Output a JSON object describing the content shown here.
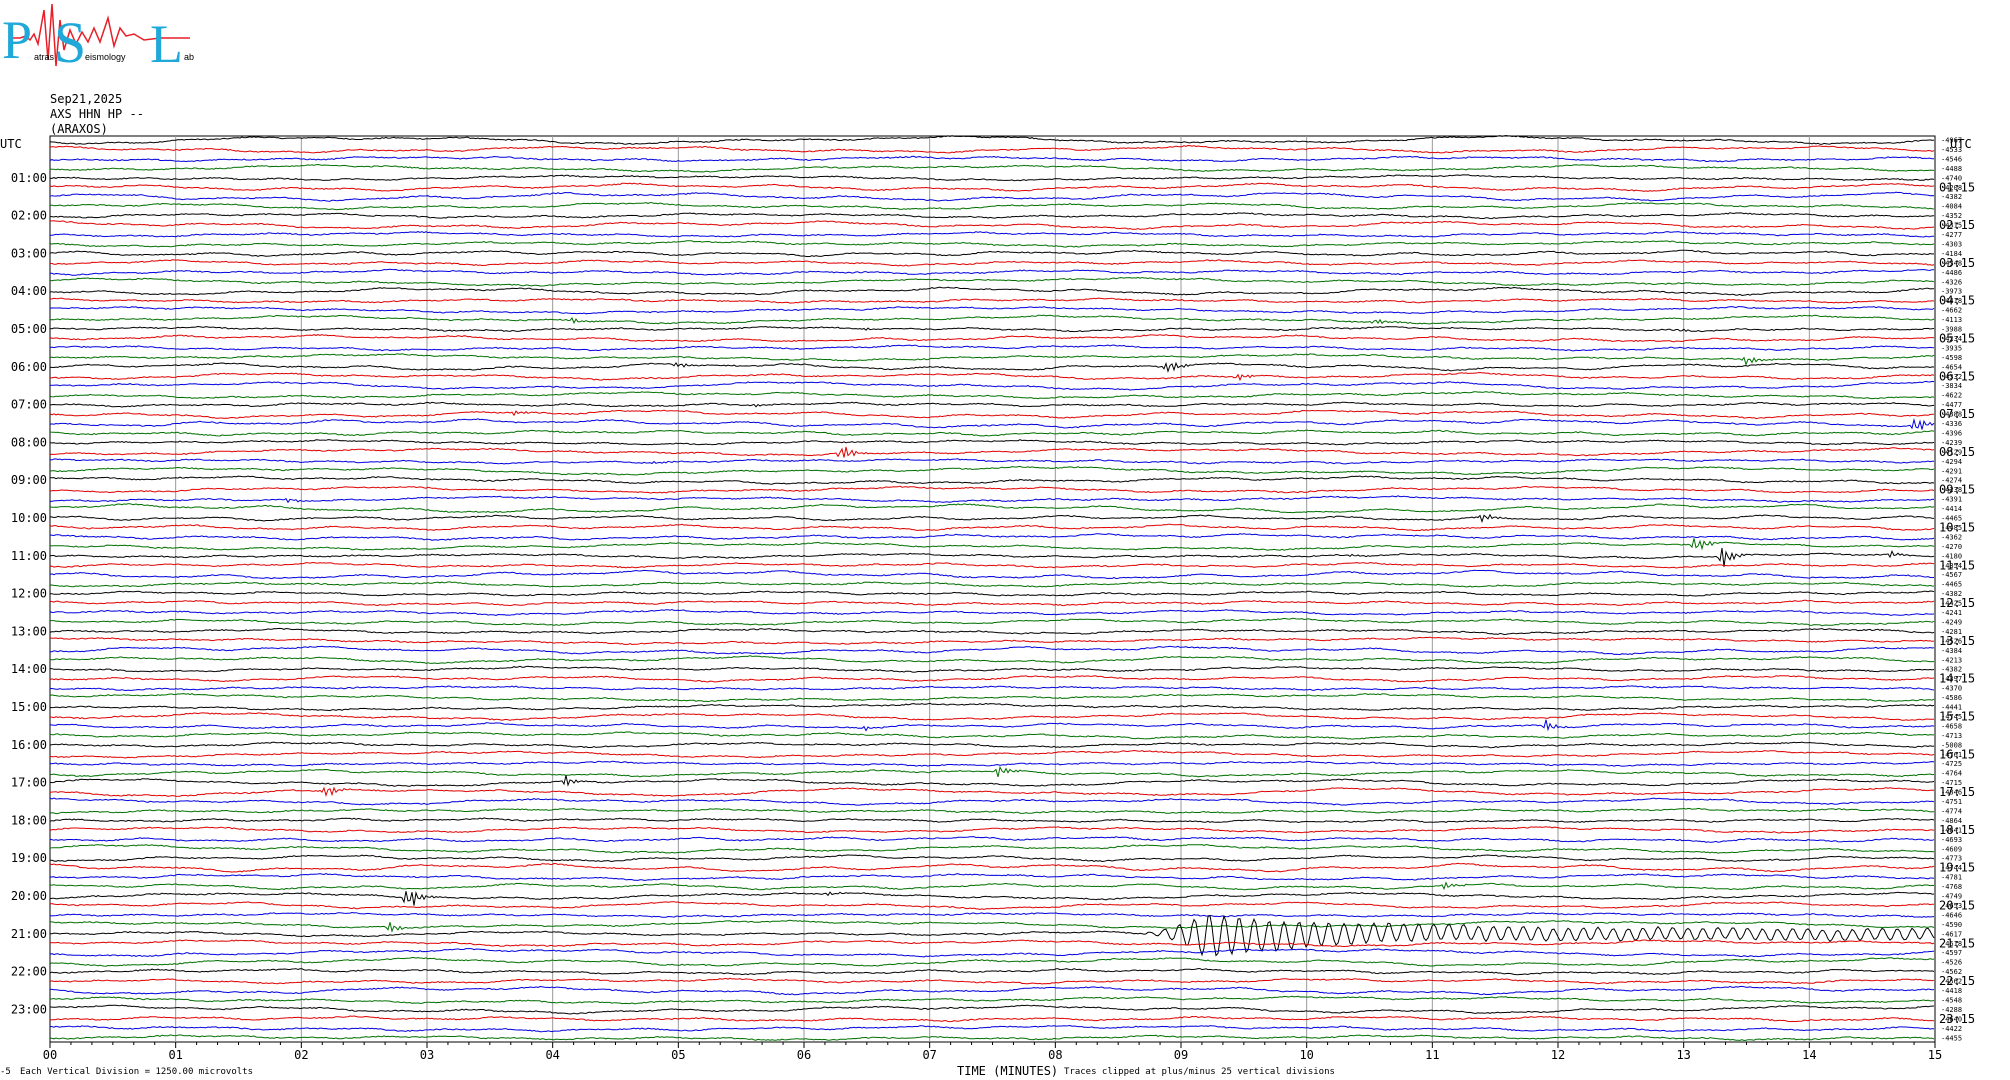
{
  "logo": {
    "letters": [
      "P",
      "S",
      "L"
    ],
    "small_text": [
      "atras",
      "eismology",
      "ab"
    ],
    "colors": {
      "blue": "#1fa8d8",
      "red": "#e81e28"
    }
  },
  "header": {
    "date": "Sep21,2025",
    "station": "AXS HHN HP --",
    "location": "(ARAXOS)"
  },
  "left_axis_title": "UTC",
  "right_axis_title": "UTC",
  "footer": {
    "vertical_division": "Each Vertical Division = 1250.00 microvolts",
    "x_title": "TIME (MINUTES)",
    "clip_note": "Traces clipped at plus/minus 25 vertical divisions",
    "corner_mark": "-5"
  },
  "chart_data": {
    "type": "line",
    "title": "",
    "xlabel": "TIME (MINUTES)",
    "ylabel": "UTC",
    "xlim": [
      0,
      15
    ],
    "x_ticks": [
      "00",
      "01",
      "02",
      "03",
      "04",
      "05",
      "06",
      "07",
      "08",
      "09",
      "10",
      "11",
      "12",
      "13",
      "14",
      "15"
    ],
    "grid": true,
    "trace_colors": [
      "#000000",
      "#e00000",
      "#0000e0",
      "#007000"
    ],
    "left_labels": [
      "01:00",
      "02:00",
      "03:00",
      "04:00",
      "05:00",
      "06:00",
      "07:00",
      "08:00",
      "09:00",
      "10:00",
      "11:00",
      "12:00",
      "13:00",
      "14:00",
      "15:00",
      "16:00",
      "17:00",
      "18:00",
      "19:00",
      "20:00",
      "21:00",
      "22:00",
      "23:00"
    ],
    "right_labels": [
      "01:15",
      "02:15",
      "03:15",
      "04:15",
      "05:15",
      "06:15",
      "07:15",
      "08:15",
      "09:15",
      "10:15",
      "11:15",
      "12:15",
      "13:15",
      "14:15",
      "15:15",
      "16:15",
      "17:15",
      "18:15",
      "19:15",
      "20:15",
      "21:15",
      "22:15",
      "23:15"
    ],
    "trace_offsets": [
      "-4967",
      "-4533",
      "-4546",
      "-4488",
      "-4740",
      "-4208",
      "-4382",
      "-4084",
      "-4352",
      "-4315",
      "-4277",
      "-4303",
      "-4184",
      "-4348",
      "-4486",
      "-4326",
      "-3973",
      "-4418",
      "-4662",
      "-4113",
      "-3988",
      "-4234",
      "-3935",
      "-4598",
      "-4654",
      "-4332",
      "-3834",
      "-4622",
      "-4477",
      "-4388",
      "-4336",
      "-4396",
      "-4239",
      "-4129",
      "-4294",
      "-4291",
      "-4274",
      "-4238",
      "-4391",
      "-4414",
      "-4465",
      "-4485",
      "-4362",
      "-4270",
      "-4180",
      "-4354",
      "-4567",
      "-4465",
      "-4382",
      "-4425",
      "-4241",
      "-4249",
      "-4281",
      "-4526",
      "-4384",
      "-4213",
      "-4382",
      "-4397",
      "-4370",
      "-4586",
      "-4441",
      "-4745",
      "-4658",
      "-4713",
      "-5008",
      "-4761",
      "-4725",
      "-4764",
      "-4715",
      "-4846",
      "-4751",
      "-4774",
      "-4864",
      "-4841",
      "-4693",
      "-4609",
      "-4773",
      "-4744",
      "-4781",
      "-4768",
      "-4749",
      "-4653",
      "-4646",
      "-4590",
      "-4617",
      "-4618",
      "-4597",
      "-4526",
      "-4562",
      "-4562",
      "-4418",
      "-4548",
      "-4288",
      "-4640",
      "-4422",
      "-4455"
    ],
    "events": [
      {
        "trace": 19,
        "minute": 10.55,
        "size": 3
      },
      {
        "trace": 19,
        "minute": 4.15,
        "size": 3
      },
      {
        "trace": 20,
        "minute": 6.5,
        "size": 2
      },
      {
        "trace": 20,
        "minute": 13.0,
        "size": 1
      },
      {
        "trace": 23,
        "minute": 13.5,
        "size": 5
      },
      {
        "trace": 24,
        "minute": 5.0,
        "size": 3
      },
      {
        "trace": 24,
        "minute": 8.9,
        "size": 7
      },
      {
        "trace": 25,
        "minute": 9.45,
        "size": 4
      },
      {
        "trace": 28,
        "minute": 5.6,
        "size": 2
      },
      {
        "trace": 29,
        "minute": 3.7,
        "size": 2
      },
      {
        "trace": 30,
        "minute": 14.85,
        "size": 8
      },
      {
        "trace": 33,
        "minute": 6.3,
        "size": 8
      },
      {
        "trace": 34,
        "minute": 4.8,
        "size": 2
      },
      {
        "trace": 38,
        "minute": 1.9,
        "size": 2
      },
      {
        "trace": 40,
        "minute": 11.4,
        "size": 4
      },
      {
        "trace": 43,
        "minute": 13.1,
        "size": 8
      },
      {
        "trace": 44,
        "minute": 13.3,
        "size": 12
      },
      {
        "trace": 44,
        "minute": 14.65,
        "size": 3
      },
      {
        "trace": 44,
        "minute": 10.35,
        "size": 2
      },
      {
        "trace": 62,
        "minute": 6.5,
        "size": 2
      },
      {
        "trace": 62,
        "minute": 11.9,
        "size": 6
      },
      {
        "trace": 67,
        "minute": 7.55,
        "size": 5
      },
      {
        "trace": 68,
        "minute": 4.1,
        "size": 5
      },
      {
        "trace": 69,
        "minute": 2.2,
        "size": 6
      },
      {
        "trace": 79,
        "minute": 11.1,
        "size": 3
      },
      {
        "trace": 83,
        "minute": 2.7,
        "size": 5
      },
      {
        "trace": 80,
        "minute": 2.85,
        "size": 12
      },
      {
        "trace": 80,
        "minute": 6.2,
        "size": 2
      }
    ],
    "teleseism": {
      "trace": 84,
      "start_minute": 8.6,
      "peak_minute": 9.2,
      "amplitude": 22
    }
  }
}
